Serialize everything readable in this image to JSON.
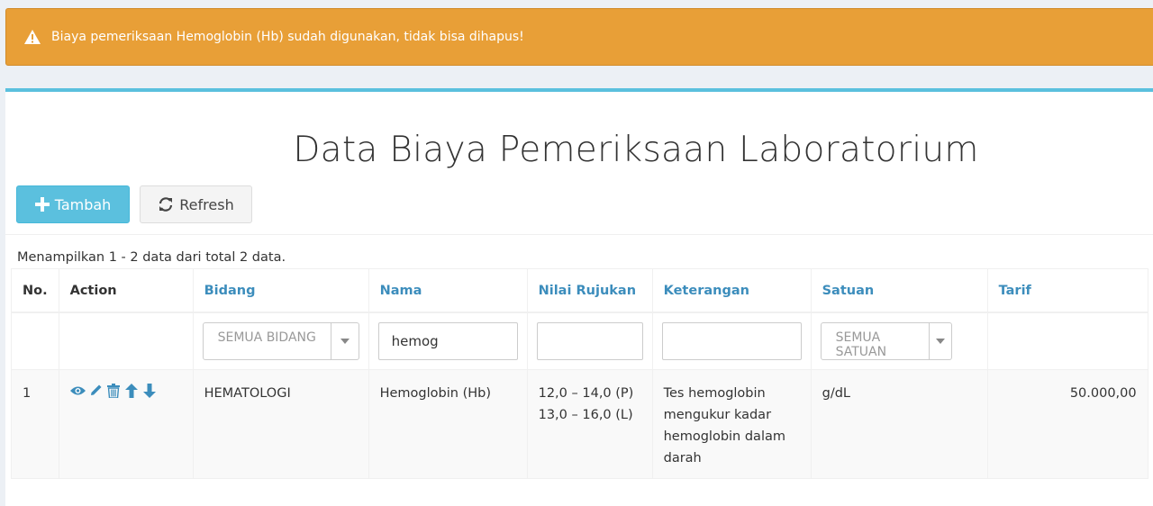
{
  "alert": {
    "message": "Biaya pemeriksaan Hemoglobin (Hb) sudah digunakan, tidak bisa dihapus!"
  },
  "page": {
    "title": "Data Biaya Pemeriksaan Laboratorium"
  },
  "toolbar": {
    "add_label": "Tambah",
    "refresh_label": "Refresh"
  },
  "summary": "Menampilkan 1 - 2 data dari total 2 data.",
  "table": {
    "headers": [
      "No.",
      "Action",
      "Bidang",
      "Nama",
      "Nilai Rujukan",
      "Keterangan",
      "Satuan",
      "Tarif"
    ],
    "filters": {
      "bidang": "SEMUA BIDANG",
      "nama": "hemog",
      "nilai_rujukan": "",
      "keterangan": "",
      "satuan": "SEMUA SATUAN"
    },
    "rows": [
      {
        "no": "1",
        "bidang": "HEMATOLOGI",
        "nama": "Hemoglobin (Hb)",
        "nilai_rujukan": [
          "12,0 – 14,0 (P)",
          "13,0 – 16,0 (L)"
        ],
        "keterangan": [
          "Tes hemoglobin",
          "mengukur kadar",
          "hemoglobin dalam",
          "darah"
        ],
        "satuan": "g/dL",
        "tarif": "50.000,00"
      }
    ]
  },
  "colors": {
    "alert": "#e89f37",
    "accent": "#3c8dbc",
    "info": "#5bc0de"
  },
  "icons": [
    "warning-icon",
    "plus-icon",
    "refresh-icon",
    "eye-icon",
    "pencil-icon",
    "trash-icon",
    "arrow-up-icon",
    "arrow-down-icon",
    "caret-down-icon"
  ]
}
